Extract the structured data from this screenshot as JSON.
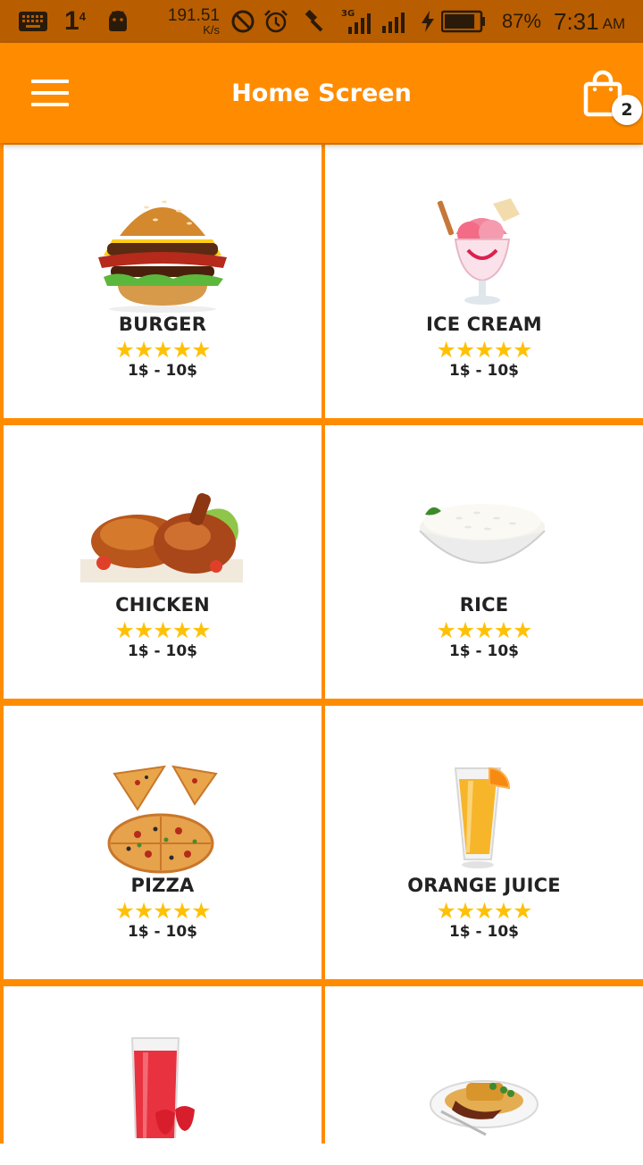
{
  "status_bar": {
    "notification_count": "1",
    "notification_sup": "4",
    "net_speed_value": "191.51",
    "net_speed_unit": "K/s",
    "network_type": "3G",
    "battery_percent": "87%",
    "battery_level": 0.87,
    "time": "7:31",
    "ampm": "AM",
    "icons": [
      "keyboard-icon",
      "android-icon",
      "do-not-disturb-icon",
      "alarm-icon",
      "hammer-icon",
      "signal-3g-icon",
      "signal-icon",
      "charging-icon",
      "battery-icon"
    ]
  },
  "app_bar": {
    "title": "Home Screen",
    "menu_icon": "hamburger-menu-icon",
    "cart_icon": "shopping-bag-icon",
    "cart_count": "2",
    "color": "#ff8c00"
  },
  "items": [
    {
      "name": "BURGER",
      "rating": "★★★★★",
      "price": "1$ - 10$",
      "icon": "burger-image"
    },
    {
      "name": "ICE CREAM",
      "rating": "★★★★★",
      "price": "1$ - 10$",
      "icon": "ice-cream-image"
    },
    {
      "name": "CHICKEN",
      "rating": "★★★★★",
      "price": "1$ - 10$",
      "icon": "chicken-image"
    },
    {
      "name": "RICE",
      "rating": "★★★★★",
      "price": "1$ - 10$",
      "icon": "rice-image"
    },
    {
      "name": "PIZZA",
      "rating": "★★★★★",
      "price": "1$ - 10$",
      "icon": "pizza-image"
    },
    {
      "name": "ORANGE JUICE",
      "rating": "★★★★★",
      "price": "1$ - 10$",
      "icon": "orange-juice-image"
    },
    {
      "name": "",
      "rating": "",
      "price": "",
      "icon": "red-juice-image"
    },
    {
      "name": "",
      "rating": "",
      "price": "",
      "icon": "pasta-plate-image"
    }
  ],
  "colors": {
    "accent": "#ff8c00",
    "status_bar": "#b85e00",
    "star": "#ffc107",
    "text": "#222222"
  }
}
